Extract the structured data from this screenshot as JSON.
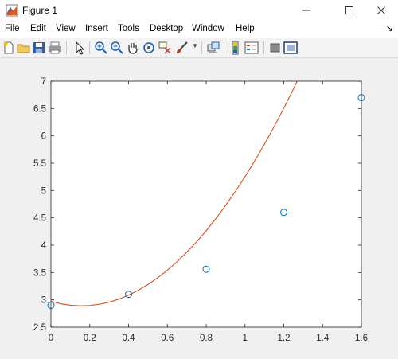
{
  "window": {
    "title": "Figure 1",
    "minimize_icon": "minimize-icon",
    "maximize_icon": "maximize-icon",
    "close_icon": "close-icon"
  },
  "menu": {
    "items": [
      "File",
      "Edit",
      "View",
      "Insert",
      "Tools",
      "Desktop",
      "Window",
      "Help"
    ],
    "dock_icon": "dock-arrow-icon"
  },
  "toolbar": {
    "icons": [
      "new-figure-icon",
      "open-file-icon",
      "save-icon",
      "print-icon",
      "pointer-icon",
      "zoom-in-icon",
      "zoom-out-icon",
      "pan-hand-icon",
      "rotate-3d-icon",
      "data-cursor-icon",
      "brush-icon",
      "link-plot-icon",
      "colorbar-icon",
      "legend-icon",
      "hide-plot-tools-icon",
      "show-plot-tools-icon"
    ],
    "colors": {
      "accent_blue": "#1f5fb4",
      "accent_red": "#c0392b"
    }
  },
  "chart_data": {
    "type": "scatter",
    "title": "",
    "xlabel": "",
    "ylabel": "",
    "xlim": [
      0,
      1.6
    ],
    "ylim": [
      2.5,
      7
    ],
    "xticks": [
      0,
      0.2,
      0.4,
      0.6,
      0.8,
      1,
      1.2,
      1.4,
      1.6
    ],
    "yticks": [
      2.5,
      3,
      3.5,
      4,
      4.5,
      5,
      5.5,
      6,
      6.5,
      7
    ],
    "grid": false,
    "series": [
      {
        "type": "scatter",
        "marker": "circle",
        "color": "#0072bd",
        "x": [
          0,
          0.4,
          0.8,
          1.2,
          1.6
        ],
        "y": [
          2.9,
          3.1,
          3.56,
          4.6,
          6.7
        ]
      },
      {
        "type": "line",
        "color": "#d95319",
        "x": [
          0,
          0.05,
          0.1,
          0.15,
          0.2,
          0.25,
          0.3,
          0.35,
          0.4,
          0.45,
          0.5,
          0.55,
          0.6,
          0.65,
          0.7,
          0.75,
          0.8,
          0.85,
          0.9,
          0.95,
          1,
          1.05,
          1.1,
          1.15,
          1.2,
          1.25,
          1.3,
          1.35,
          1.4,
          1.45,
          1.5,
          1.55,
          1.6
        ],
        "y": [
          2.974,
          2.929,
          2.902,
          2.891,
          2.897,
          2.919,
          2.958,
          3.014,
          3.086,
          3.175,
          3.281,
          3.403,
          3.542,
          3.697,
          3.87,
          4.058,
          4.264,
          4.486,
          4.725,
          4.98,
          5.252,
          5.541,
          5.846,
          6.168,
          6.506,
          6.861,
          7.233,
          7.621,
          8.026,
          8.448,
          8.886,
          9.341,
          9.812
        ]
      }
    ]
  }
}
